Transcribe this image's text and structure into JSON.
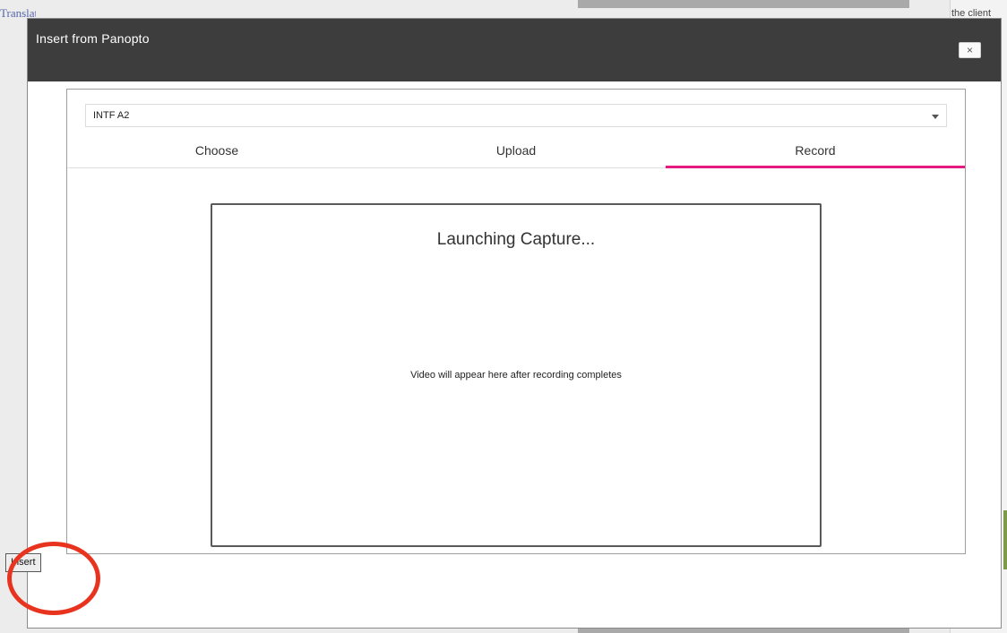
{
  "background": {
    "left_text": "Translation IA",
    "right_text": "the client"
  },
  "dialog": {
    "title": "Insert from Panopto",
    "close_label": "×"
  },
  "folder_select": {
    "selected": "INTF A2"
  },
  "tabs": [
    {
      "label": "Choose",
      "active": false
    },
    {
      "label": "Upload",
      "active": false
    },
    {
      "label": "Record",
      "active": true
    }
  ],
  "record": {
    "title": "Launching Capture...",
    "message": "Video will appear here after recording completes"
  },
  "footer": {
    "insert_label": "Insert"
  },
  "annotation": {
    "highlight_color": "#e8331e"
  },
  "colors": {
    "header_bg": "#3d3d3d",
    "active_tab_accent": "#e5197f"
  }
}
